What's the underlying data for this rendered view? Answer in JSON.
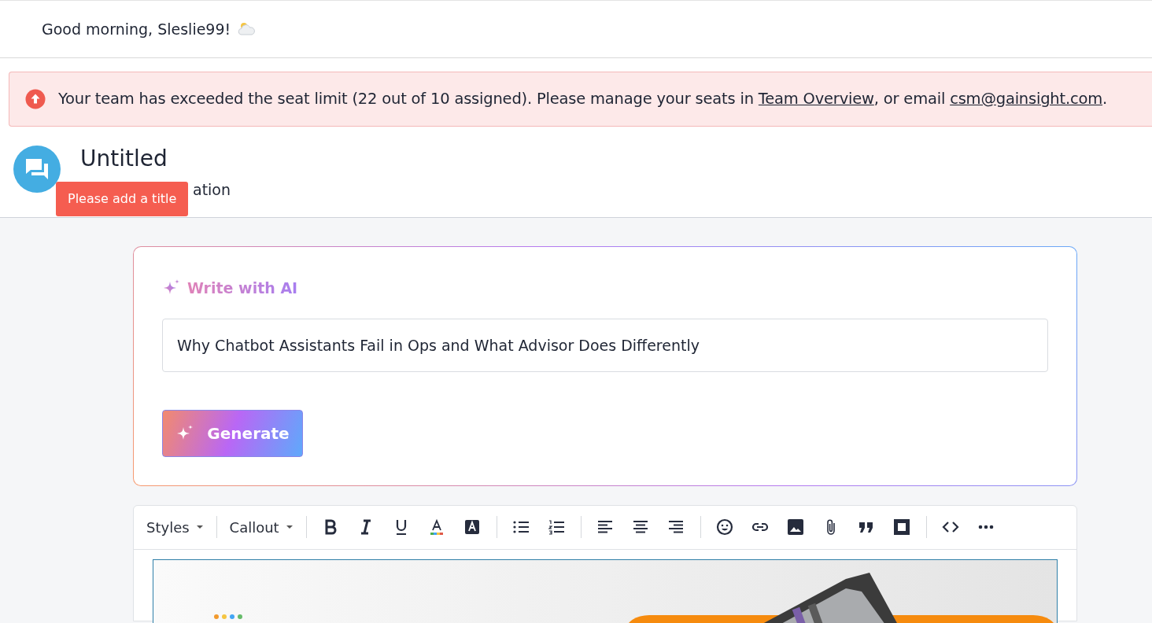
{
  "header": {
    "greeting": "Good morning, Sleslie99!"
  },
  "alert": {
    "segments": [
      {
        "kind": "text",
        "text": "Your team has exceeded the seat limit (22 out of 10 assigned). Please manage your seats in "
      },
      {
        "kind": "link",
        "text": "Team Overview"
      },
      {
        "kind": "text",
        "text": ", or email "
      },
      {
        "kind": "link",
        "text": "csm@gainsight.com"
      },
      {
        "kind": "text",
        "text": "."
      }
    ]
  },
  "post": {
    "title": "Untitled",
    "subtitle": "ation",
    "tooltip": "Please add a title"
  },
  "ai_panel": {
    "heading": "Write with AI",
    "prompt_value": "Why Chatbot Assistants Fail in Ops and What Advisor Does Differently",
    "button": "Generate"
  },
  "editor": {
    "dropdowns": [
      "Styles",
      "Callout"
    ]
  }
}
